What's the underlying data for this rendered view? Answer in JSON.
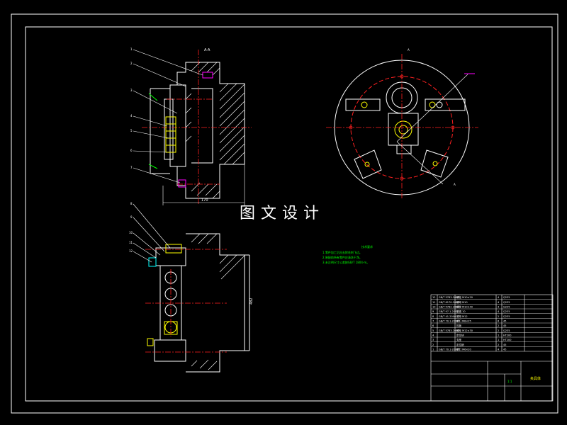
{
  "watermark": "图文设计",
  "balloons": [
    "1",
    "2",
    "3",
    "4",
    "5",
    "6",
    "7",
    "8",
    "9",
    "10",
    "11",
    "12"
  ],
  "dimensions": {
    "side_width": "170",
    "bottom_height": "482",
    "top_label": "A-A",
    "section_mark": "A",
    "section_mark_b": "A"
  },
  "tech_req": {
    "title": "技术要求",
    "lines": [
      "1.零件加工后应去除毛刺飞边。",
      "2.装配前所有零件应清洗干净。",
      "3.未注明尺寸公差按GB/T 1804-m。"
    ]
  },
  "parts_list": {
    "rows": [
      [
        "12",
        "GB/T 5783-2000",
        "螺栓 M10×20",
        "4",
        "Q235"
      ],
      [
        "11",
        "GB/T 6170-2000",
        "螺母 M10",
        "4",
        "Q235"
      ],
      [
        "10",
        "GB/T 5782-2000",
        "螺栓 M10×40",
        "4",
        "Q235"
      ],
      [
        "9",
        "GB/T 97.1-2002",
        "垫圈 10",
        "4",
        "Q235"
      ],
      [
        "8",
        "GB/T 41-2000",
        "螺母 M12",
        "2",
        "Q235"
      ],
      [
        "7",
        "GB/T 70.1-2008",
        "螺钉 M8×25",
        "6",
        "45"
      ],
      [
        "6",
        "",
        "压板",
        "2",
        "45"
      ],
      [
        "5",
        "GB/T 5783-2000",
        "螺栓 M12×30",
        "2",
        "Q235"
      ],
      [
        "4",
        "",
        "定位块",
        "1",
        "HT200"
      ],
      [
        "3",
        "",
        "支座",
        "1",
        "HT200"
      ],
      [
        "2",
        "",
        "定位销",
        "2",
        "45"
      ],
      [
        "1",
        "GB/T 70.1-2008",
        "螺钉 M6×20",
        "4",
        "45"
      ]
    ]
  },
  "title_block": {
    "name": "夹具体",
    "scale": "1:1"
  },
  "colors": {
    "white": "#ffffff",
    "red": "#ff2020",
    "yellow": "#ffff00",
    "green": "#00ff00",
    "magenta": "#ff00ff",
    "cyan": "#00ffff"
  }
}
